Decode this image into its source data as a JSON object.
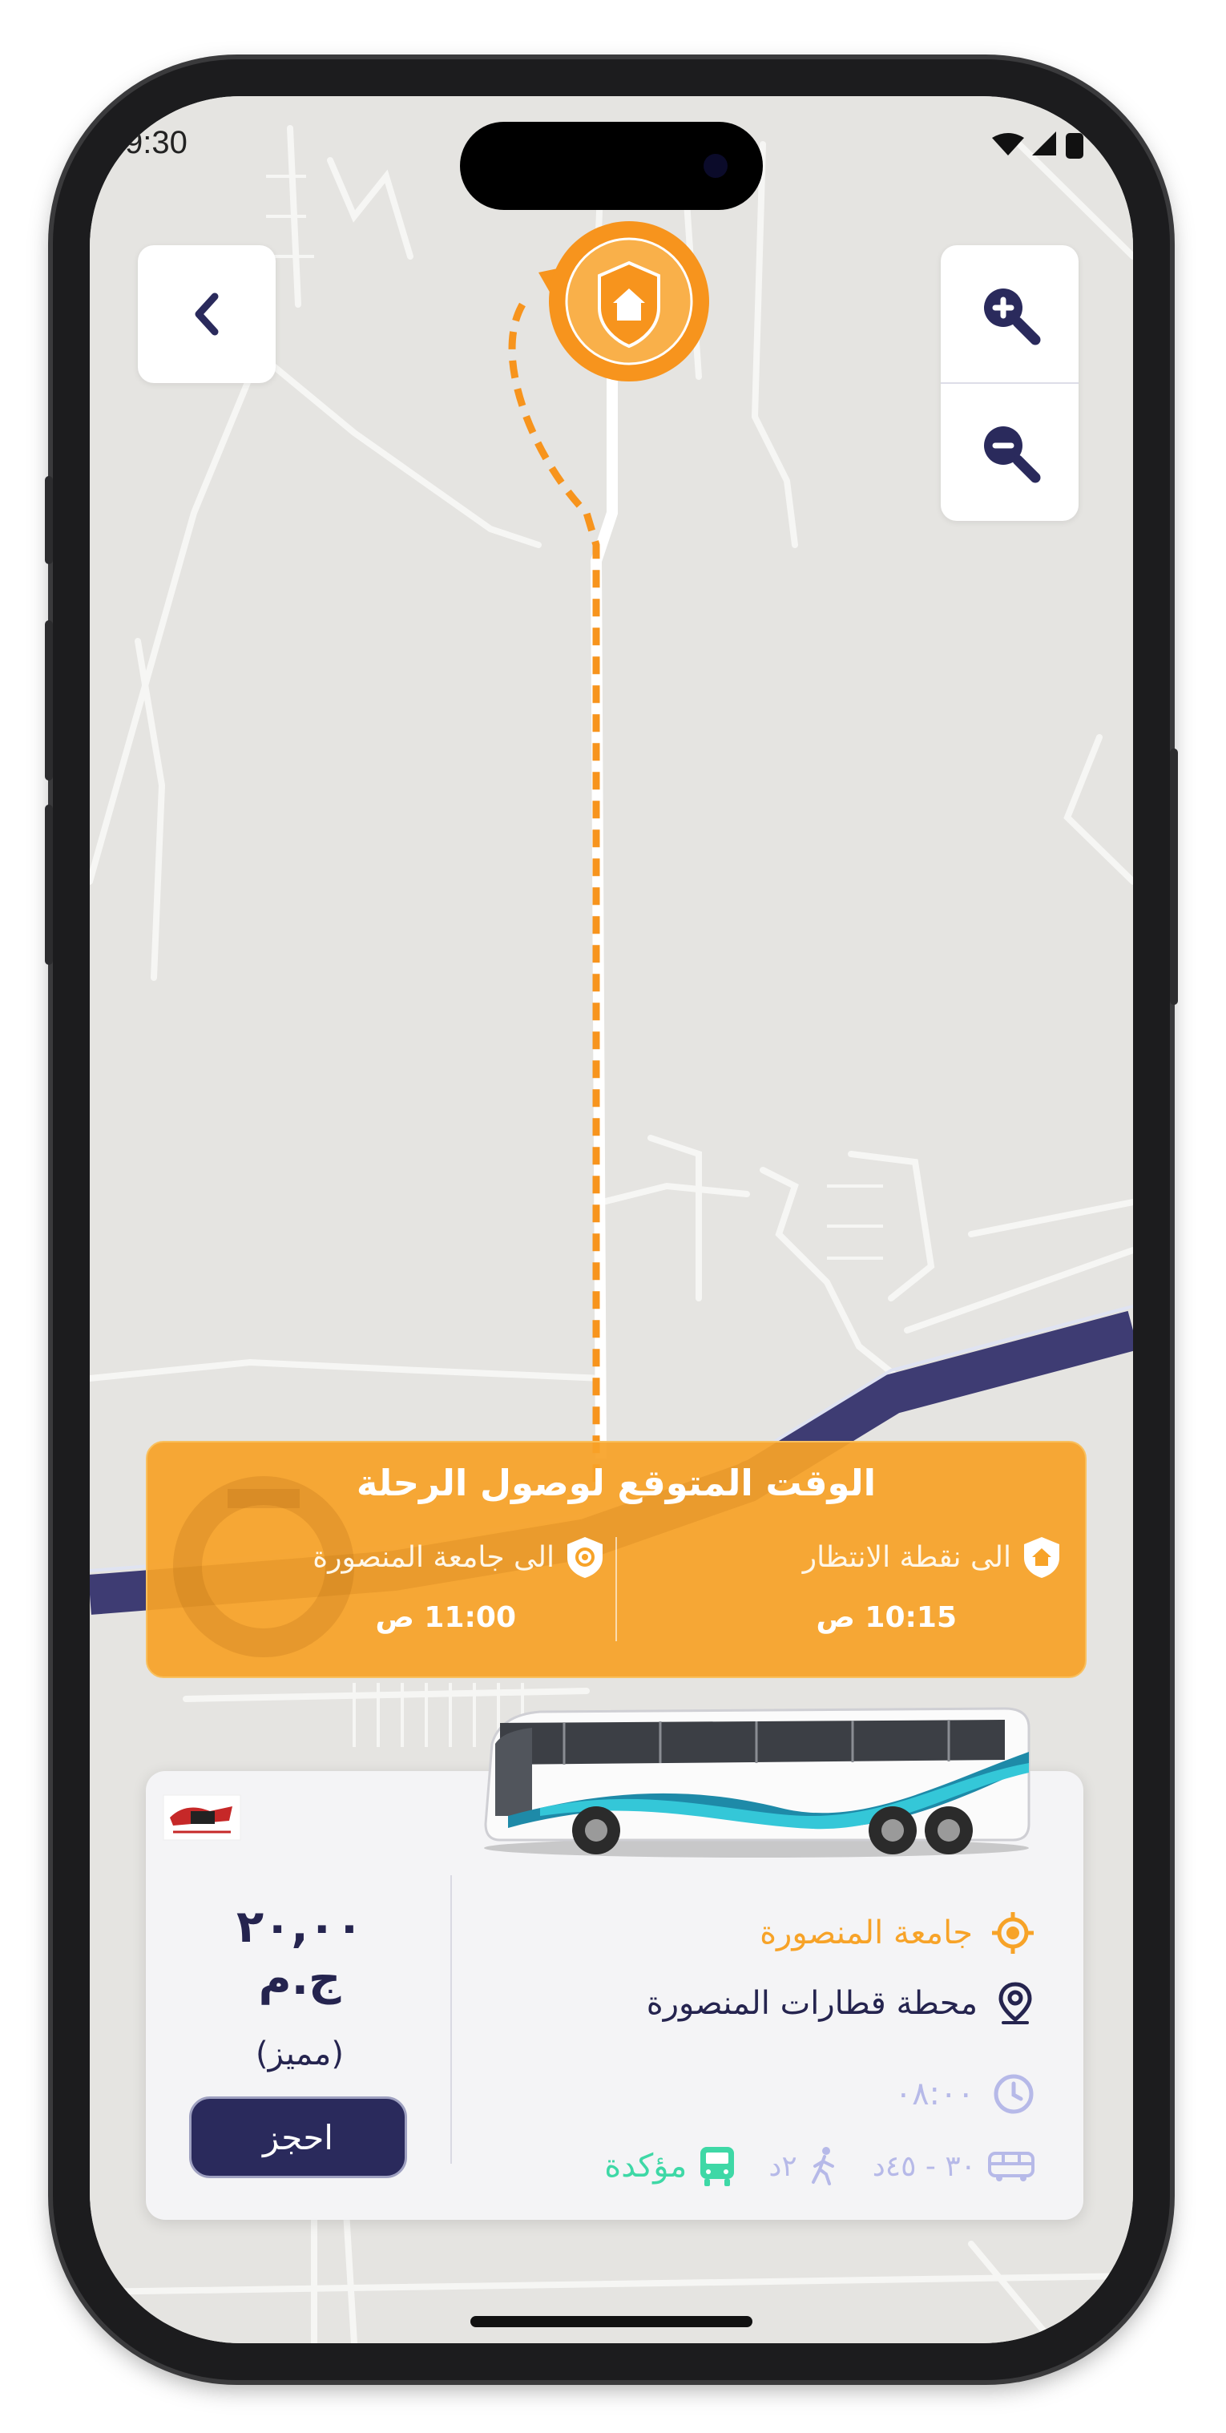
{
  "status_bar": {
    "time": "9:30"
  },
  "map": {
    "back_label": "<",
    "zoom_in_label": "zoom in",
    "zoom_out_label": "zoom out",
    "route_color": "#f7941d",
    "river_color": "#3e3c73"
  },
  "eta": {
    "title": "الوقت المتوقع لوصول الرحلة",
    "waiting_point_label": "الى نقطة الانتظار",
    "waiting_point_time": "10:15 ص",
    "university_label": "الى جامعة المنصورة",
    "university_time": "11:00 ص"
  },
  "trip": {
    "price": "٢٠,٠٠ ج.م",
    "tier": "(مميز)",
    "book_label": "احجز",
    "destination": "جامعة المنصورة",
    "origin": "محطة قطارات المنصورة",
    "departure_time": "٠٨:٠٠",
    "duration": "٣٠ - ٤٥د",
    "walk": "٢د",
    "status": "مؤكدة",
    "colors": {
      "accent": "#f7a328",
      "navy": "#25244f",
      "confirmed": "#3ed8a6",
      "muted": "#b6b9e8"
    }
  }
}
